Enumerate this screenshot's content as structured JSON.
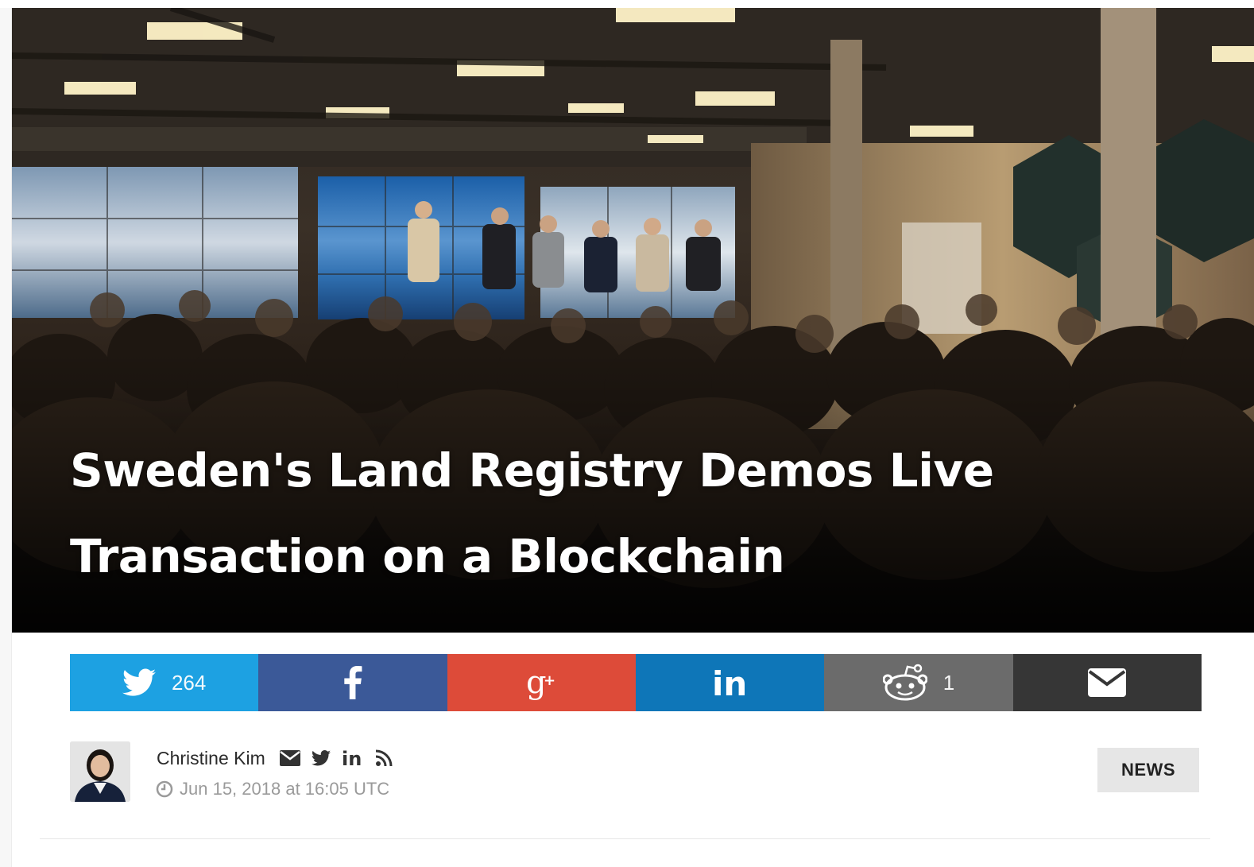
{
  "article": {
    "title": "Sweden's Land Registry Demos Live Transaction on a Blockchain",
    "category": "NEWS"
  },
  "share": {
    "twitter": {
      "icon": "twitter-icon",
      "count": "264",
      "color": "#1da1e2"
    },
    "facebook": {
      "icon": "facebook-icon",
      "color": "#3b5998"
    },
    "googleplus": {
      "icon": "google-plus-icon",
      "color": "#dd4b39"
    },
    "linkedin": {
      "icon": "linkedin-icon",
      "color": "#0e76b8"
    },
    "reddit": {
      "icon": "reddit-icon",
      "count": "1",
      "color": "#6b6b6b"
    },
    "email": {
      "icon": "envelope-icon",
      "color": "#363636"
    }
  },
  "author": {
    "name": "Christine Kim",
    "date": "Jun 15, 2018 at 16:05 UTC",
    "contact_icons": [
      "envelope-icon",
      "twitter-icon",
      "linkedin-icon",
      "rss-icon"
    ]
  }
}
